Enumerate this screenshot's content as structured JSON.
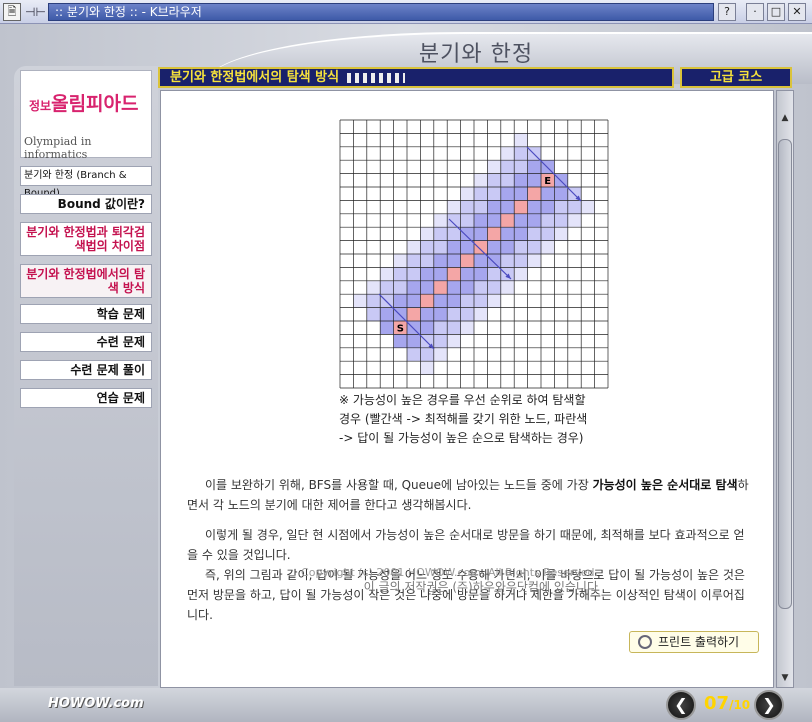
{
  "window": {
    "title": ":: 분기와 한정 :: - K브라우저",
    "help_label": "?",
    "minimize_label": "·",
    "maximize_label": "□",
    "close_label": "✕"
  },
  "page": {
    "title": "분기와 한정",
    "topic": "분기와 한정법에서의 탐색 방식",
    "level": "고급 코스"
  },
  "logo": {
    "main_small": "정보",
    "main": "올림피아드",
    "sub": "Olympiad in informatics"
  },
  "sidebar": {
    "items": [
      {
        "label": "분기와 한정 (Branch & Bound)"
      },
      {
        "label": "Bound 값이란?"
      },
      {
        "label": "분기와 한정법과 퇴각검색법의 차이점"
      },
      {
        "label": "분기와 한정법에서의 탐색 방식"
      },
      {
        "label": "학습 문제"
      },
      {
        "label": "수련 문제"
      },
      {
        "label": "수련 문제 풀이"
      },
      {
        "label": "연습 문제"
      }
    ]
  },
  "figure": {
    "start_label": "S",
    "end_label": "E",
    "caption_1": "※ 가능성이 높은 경우를 우선 순위로 하여 탐색할",
    "caption_2": "경우 (빨간색 -> 최적해를 갖기 위한 노드, 파란색",
    "caption_3": "-> 답이 될 가능성이 높은 순으로 탐색하는 경우)"
  },
  "paragraphs": {
    "p1_a": "이를 보완하기 위해, BFS를 사용할 때, Queue에 남아있는 노드들 중에 가장 ",
    "p1_b": "가능성이 높은 순서대로 탐색",
    "p1_c": "하면서 각 노드의 분기에 대한 제어를 한다고 생각해봅시다.",
    "p2": "이렇게 될 경우, 일단 현 시점에서 가능성이 높은 순서대로 방문을 하기 때문에, 최적해를 보다 효과적으로 얻을 수 있을 것입니다.",
    "p3": "즉, 위의 그림과 같이, 답이 될 가능성을 어느 정도 수용해 가면서, 이를 바탕으로 답이 될 가능성이 높은 것은 먼저 방문을 하고, 답이 될 가능성이 작은 것은 나중에 방문을 하거나 제한을 가해주는 이상적인 탐색이 이루어집니다."
  },
  "print_button": "프린트 출력하기",
  "copyright_1": "Copyright (c) 2001 HOWOW.com. All Rights Reserved.",
  "copyright_2": "이 글의 저작권은 (주)하우와우닷컴에 있습니다",
  "footer": {
    "logo": "HOWOW.com",
    "prev_label": "❮",
    "next_label": "❯",
    "page_current": "07",
    "page_total": "/10"
  },
  "colors": {
    "accent_navy": "#19216b",
    "accent_yellow": "#f6e23c",
    "menu_red": "#c4124f",
    "path_red": "#f4a6a6",
    "light_blue": "#c9c9f5",
    "dark_blue": "#a6a6ee"
  }
}
